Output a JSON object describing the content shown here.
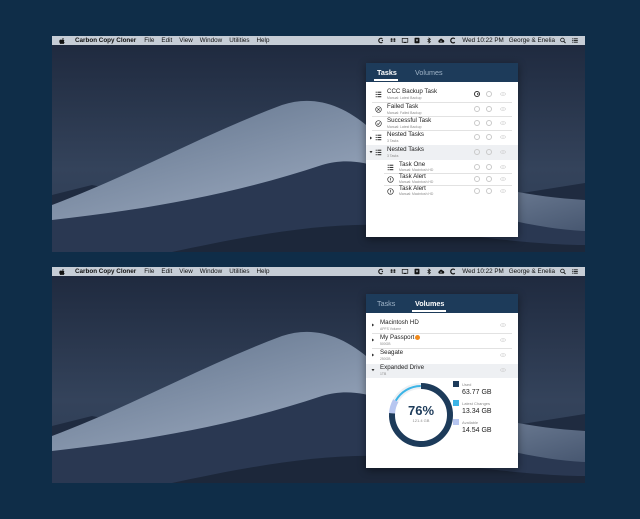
{
  "menubar": {
    "app_name": "Carbon Copy Cloner",
    "menus": [
      "File",
      "Edit",
      "View",
      "Window",
      "Utilities",
      "Help"
    ],
    "clock": "Wed 10:22 PM",
    "user": "George & Enelia",
    "icons": [
      "apple-icon",
      "ccc-icon",
      "dropbox-icon",
      "display-icon",
      "shield-icon",
      "bluetooth-icon",
      "cloud-icon",
      "ccc-icon",
      "search-icon",
      "list-icon"
    ]
  },
  "tasks_panel": {
    "tabs": [
      "Tasks",
      "Volumes"
    ],
    "active_tab": "Tasks",
    "rows": [
      {
        "name": "CCC Backup Task",
        "sub": "Manual: Latest Backup",
        "icon": "list-icon",
        "control": "play"
      },
      {
        "name": "Failed Task",
        "sub": "Manual: Failed Backup",
        "icon": "failed-icon",
        "control": "idle"
      },
      {
        "name": "Successful Task",
        "sub": "Manual: Latest Backup",
        "icon": "check-icon",
        "control": "idle"
      },
      {
        "name": "Nested Tasks",
        "sub": "3 Tasks",
        "icon": "list-icon",
        "control": "idle",
        "expandable": true
      },
      {
        "name": "Nested Tasks",
        "sub": "3 Tasks",
        "icon": "list-icon",
        "control": "idle",
        "expanded": true
      },
      {
        "name": "Task One",
        "sub": "Manual: Macintosh HD",
        "icon": "list-icon",
        "control": "idle",
        "child": true
      },
      {
        "name": "Task Alert",
        "sub": "Manual: Macintosh HD",
        "icon": "alert-icon",
        "control": "idle",
        "child": true
      },
      {
        "name": "Task Alert",
        "sub": "Manual: Macintosh HD",
        "icon": "alert-icon",
        "control": "idle",
        "child": true
      }
    ]
  },
  "volumes_panel": {
    "tabs": [
      "Tasks",
      "Volumes"
    ],
    "active_tab": "Volumes",
    "volumes": [
      {
        "name": "Macintosh HD",
        "sub": "APFS Volume"
      },
      {
        "name": "My Passport",
        "sub": "500GB",
        "badge": true
      },
      {
        "name": "Seagate",
        "sub": "250GB"
      },
      {
        "name": "Expanded Drive",
        "sub": "1TB"
      }
    ],
    "usage": {
      "percent_label": "76%",
      "capacity": "121.4 GB",
      "used_fraction": 0.76,
      "used_label": "Used",
      "used_value": "63.77 GB",
      "changes_label": "Latest Changes",
      "changes_value": "13.34 GB",
      "available_label": "Available",
      "available_value": "14.54 GB",
      "colors": {
        "used": "#1d3b5a",
        "changes": "#3bb4e6",
        "available": "#b7c6f0"
      }
    }
  }
}
